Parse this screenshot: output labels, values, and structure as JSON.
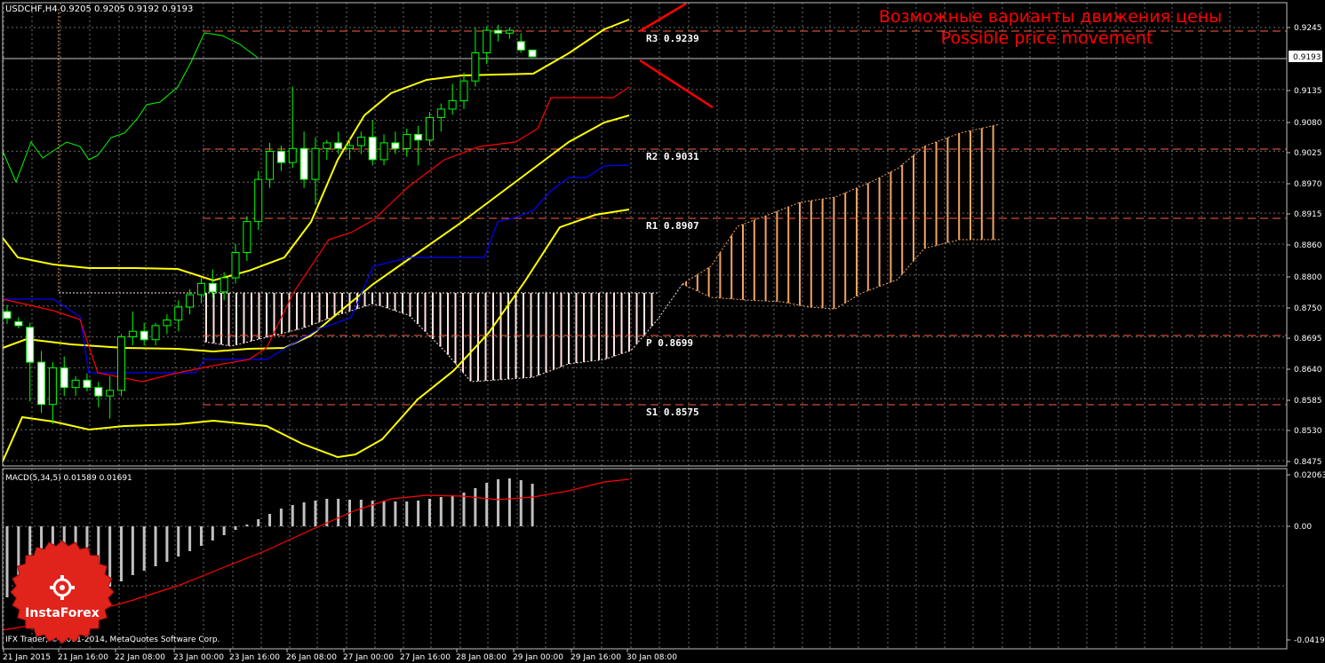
{
  "header": {
    "symbol_label": "USDCHF,H4",
    "ohlc": "0.9205 0.9205 0.9192 0.9193"
  },
  "annotation": {
    "line1": "Возможные варианты движения цены",
    "line2": "Possible price movement",
    "color": "#ff0000"
  },
  "levels": [
    {
      "name": "R3",
      "value": 0.9239,
      "text": "R3  0.9239"
    },
    {
      "name": "R2",
      "value": 0.9031,
      "text": "R2  0.9031"
    },
    {
      "name": "R1",
      "value": 0.8907,
      "text": "R1  0.8907"
    },
    {
      "name": "P",
      "value": 0.8699,
      "text": "P   0.8699"
    },
    {
      "name": "S1",
      "value": 0.8575,
      "text": "S1  0.8575"
    }
  ],
  "current_price_label": "0.9193",
  "macd": {
    "label": "MACD(5,34,5) 0.01589 0.01691",
    "axis_labels": [
      "0.02063",
      "0.00",
      "-0.04194"
    ]
  },
  "copyright": "IFX Trader, © 2001-2014, MetaQuotes Software Corp.",
  "logo_text": "InstaForex",
  "colors": {
    "background": "#000000",
    "grid": "#6b6b6b",
    "bollinger": "#ffff00",
    "kijun": "#0000ff",
    "tenkan": "#ff0000",
    "chikou": "#00ff00",
    "cloud_bull": "#f4a460",
    "cloud_bear": "#ffe4e1",
    "levels": "#ff6040",
    "bull_candle": "#ffffff",
    "bear_candle": "#000000",
    "macd_hist": "#c0c0c0",
    "macd_signal": "#ff0000"
  },
  "chart_data": {
    "type": "candlestick",
    "price_axis_ticks": [
      0.9245,
      0.919,
      0.9135,
      0.908,
      0.9025,
      0.897,
      0.8915,
      0.886,
      0.8805,
      0.875,
      0.8695,
      0.864,
      0.8585,
      0.853,
      0.8475
    ],
    "price_axis_labels": [
      "0.9245",
      "0.9135",
      "0.9080",
      "0.9025",
      "0.8970",
      "0.8915",
      "0.8860",
      "0.8800",
      "0.8750",
      "0.8695",
      "0.8640",
      "0.8585",
      "0.8530",
      "0.8475"
    ],
    "price_range": [
      0.8475,
      0.9245
    ],
    "time_labels": [
      "21 Jan 2015",
      "21 Jan 16:00",
      "22 Jan 08:00",
      "23 Jan 00:00",
      "23 Jan 16:00",
      "26 Jan 08:00",
      "27 Jan 00:00",
      "27 Jan 16:00",
      "28 Jan 08:00",
      "29 Jan 00:00",
      "29 Jan 16:00",
      "30 Jan 08:00"
    ],
    "candles": [
      [
        0.874,
        0.8752,
        0.8718,
        0.8728
      ],
      [
        0.8722,
        0.873,
        0.871,
        0.8715
      ],
      [
        0.8712,
        0.872,
        0.858,
        0.865
      ],
      [
        0.865,
        0.867,
        0.856,
        0.8575
      ],
      [
        0.8575,
        0.865,
        0.854,
        0.864
      ],
      [
        0.864,
        0.866,
        0.859,
        0.8605
      ],
      [
        0.8605,
        0.8625,
        0.859,
        0.8618
      ],
      [
        0.8618,
        0.863,
        0.8598,
        0.8605
      ],
      [
        0.8605,
        0.8615,
        0.857,
        0.859
      ],
      [
        0.859,
        0.8625,
        0.855,
        0.86
      ],
      [
        0.86,
        0.87,
        0.859,
        0.8695
      ],
      [
        0.8695,
        0.874,
        0.868,
        0.8705
      ],
      [
        0.8705,
        0.872,
        0.868,
        0.869
      ],
      [
        0.869,
        0.872,
        0.868,
        0.8715
      ],
      [
        0.8715,
        0.8735,
        0.87,
        0.8725
      ],
      [
        0.8725,
        0.876,
        0.8705,
        0.8748
      ],
      [
        0.8748,
        0.878,
        0.8735,
        0.877
      ],
      [
        0.877,
        0.88,
        0.8755,
        0.879
      ],
      [
        0.879,
        0.8815,
        0.8765,
        0.8775
      ],
      [
        0.8775,
        0.881,
        0.876,
        0.88
      ],
      [
        0.88,
        0.886,
        0.879,
        0.8845
      ],
      [
        0.8845,
        0.891,
        0.883,
        0.89
      ],
      [
        0.89,
        0.899,
        0.8885,
        0.8975
      ],
      [
        0.8975,
        0.904,
        0.896,
        0.9025
      ],
      [
        0.9025,
        0.9035,
        0.899,
        0.9005
      ],
      [
        0.9005,
        0.914,
        0.8995,
        0.903
      ],
      [
        0.903,
        0.906,
        0.896,
        0.8975
      ],
      [
        0.8975,
        0.905,
        0.893,
        0.903
      ],
      [
        0.903,
        0.9045,
        0.901,
        0.904
      ],
      [
        0.904,
        0.906,
        0.902,
        0.903
      ],
      [
        0.903,
        0.905,
        0.901,
        0.9035
      ],
      [
        0.9035,
        0.906,
        0.902,
        0.905
      ],
      [
        0.905,
        0.908,
        0.9,
        0.901
      ],
      [
        0.901,
        0.9055,
        0.9,
        0.904
      ],
      [
        0.904,
        0.906,
        0.902,
        0.903
      ],
      [
        0.903,
        0.9065,
        0.9015,
        0.9055
      ],
      [
        0.9055,
        0.907,
        0.9,
        0.9045
      ],
      [
        0.9045,
        0.9095,
        0.9035,
        0.9085
      ],
      [
        0.9085,
        0.911,
        0.906,
        0.91
      ],
      [
        0.91,
        0.9145,
        0.909,
        0.9115
      ],
      [
        0.9115,
        0.9165,
        0.91,
        0.915
      ],
      [
        0.915,
        0.9245,
        0.914,
        0.92
      ],
      [
        0.92,
        0.9247,
        0.918,
        0.924
      ],
      [
        0.924,
        0.925,
        0.922,
        0.9235
      ],
      [
        0.9235,
        0.9245,
        0.9225,
        0.924
      ],
      [
        0.922,
        0.9235,
        0.92,
        0.9205
      ],
      [
        0.9205,
        0.9205,
        0.9192,
        0.9193
      ]
    ]
  }
}
